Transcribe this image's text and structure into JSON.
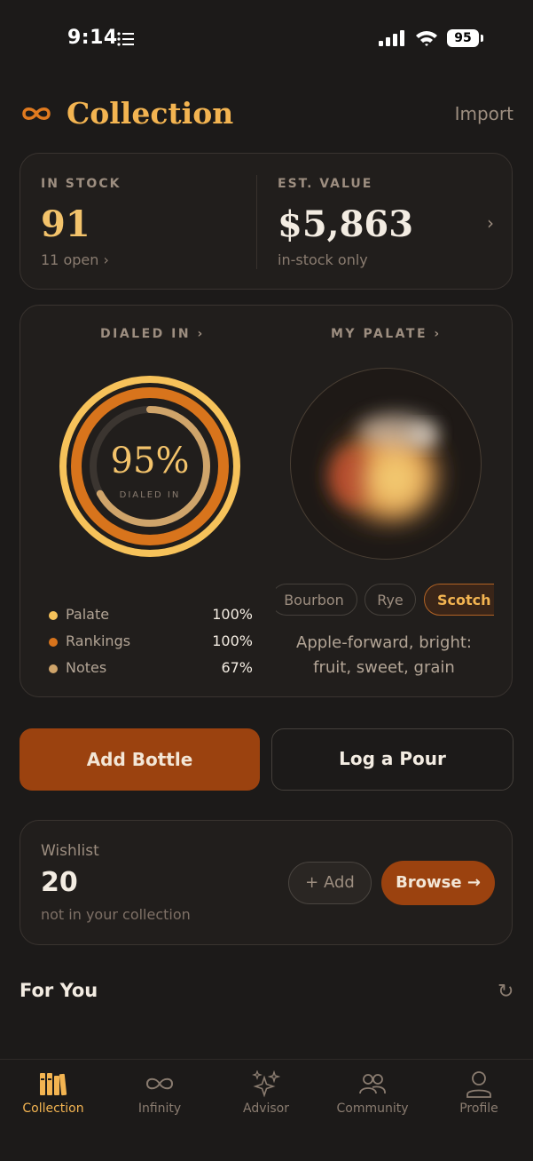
{
  "status_bar": {
    "time": "9:14",
    "battery": "95"
  },
  "header": {
    "title": "Collection",
    "import_label": "Import"
  },
  "stock": {
    "in_stock_label": "IN STOCK",
    "in_stock_value": "91",
    "open_label": "11 open ›",
    "value_label": "EST. VALUE",
    "value_amount": "$5,863",
    "value_note": "in-stock only"
  },
  "dialed": {
    "title": "DIALED IN ›",
    "percent": "95%",
    "subtitle": "DIALED IN",
    "overall_fraction": 0.95,
    "legend": [
      {
        "label": "Palate",
        "value": "100%",
        "fraction": 1.0,
        "color": "#f6c25a"
      },
      {
        "label": "Rankings",
        "value": "100%",
        "fraction": 1.0,
        "color": "#d8741c"
      },
      {
        "label": "Notes",
        "value": "67%",
        "fraction": 0.67,
        "color": "#cfa46a"
      }
    ]
  },
  "palate": {
    "title": "MY PALATE ›",
    "pills": [
      "Bourbon",
      "Rye",
      "Scotch /"
    ],
    "selected": "Scotch /",
    "description": "Apple-forward, bright: fruit, sweet, grain"
  },
  "actions": {
    "add_bottle": "Add Bottle",
    "log_pour": "Log a Pour"
  },
  "wishlist": {
    "label": "Wishlist",
    "count": "20",
    "subtitle": "not in your collection",
    "add_label": "+ Add",
    "browse_label": "Browse →"
  },
  "for_you": {
    "title": "For You",
    "refresh_icon": "↻"
  },
  "tabs": [
    {
      "label": "Collection",
      "icon": "shelf-icon",
      "active": true
    },
    {
      "label": "Infinity",
      "icon": "infinity-icon",
      "active": false
    },
    {
      "label": "Advisor",
      "icon": "sparkles-icon",
      "active": false
    },
    {
      "label": "Community",
      "icon": "people-icon",
      "active": false
    },
    {
      "label": "Profile",
      "icon": "person-icon",
      "active": false
    }
  ],
  "colors": {
    "accent": "#f3b451",
    "primary_button": "#9b420f",
    "background": "#1c1a19"
  }
}
